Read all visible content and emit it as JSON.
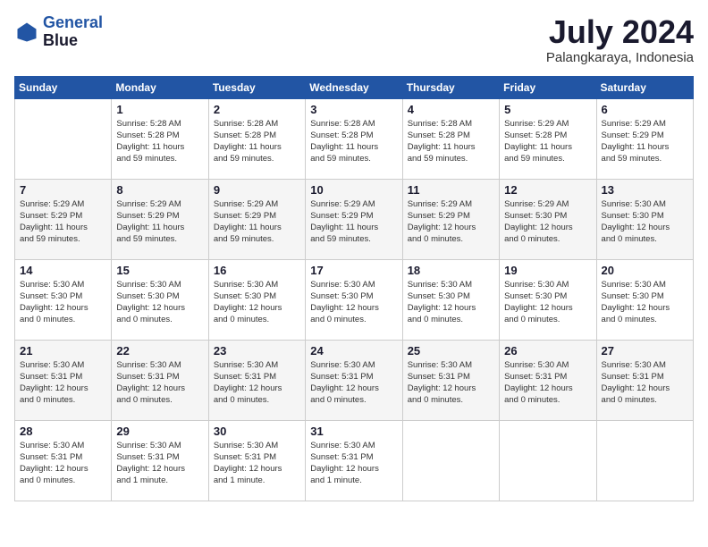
{
  "header": {
    "logo_line1": "General",
    "logo_line2": "Blue",
    "month_year": "July 2024",
    "location": "Palangkaraya, Indonesia"
  },
  "days_of_week": [
    "Sunday",
    "Monday",
    "Tuesday",
    "Wednesday",
    "Thursday",
    "Friday",
    "Saturday"
  ],
  "weeks": [
    [
      {
        "day": "",
        "info": ""
      },
      {
        "day": "1",
        "info": "Sunrise: 5:28 AM\nSunset: 5:28 PM\nDaylight: 11 hours\nand 59 minutes."
      },
      {
        "day": "2",
        "info": "Sunrise: 5:28 AM\nSunset: 5:28 PM\nDaylight: 11 hours\nand 59 minutes."
      },
      {
        "day": "3",
        "info": "Sunrise: 5:28 AM\nSunset: 5:28 PM\nDaylight: 11 hours\nand 59 minutes."
      },
      {
        "day": "4",
        "info": "Sunrise: 5:28 AM\nSunset: 5:28 PM\nDaylight: 11 hours\nand 59 minutes."
      },
      {
        "day": "5",
        "info": "Sunrise: 5:29 AM\nSunset: 5:28 PM\nDaylight: 11 hours\nand 59 minutes."
      },
      {
        "day": "6",
        "info": "Sunrise: 5:29 AM\nSunset: 5:29 PM\nDaylight: 11 hours\nand 59 minutes."
      }
    ],
    [
      {
        "day": "7",
        "info": "Sunrise: 5:29 AM\nSunset: 5:29 PM\nDaylight: 11 hours\nand 59 minutes."
      },
      {
        "day": "8",
        "info": "Sunrise: 5:29 AM\nSunset: 5:29 PM\nDaylight: 11 hours\nand 59 minutes."
      },
      {
        "day": "9",
        "info": "Sunrise: 5:29 AM\nSunset: 5:29 PM\nDaylight: 11 hours\nand 59 minutes."
      },
      {
        "day": "10",
        "info": "Sunrise: 5:29 AM\nSunset: 5:29 PM\nDaylight: 11 hours\nand 59 minutes."
      },
      {
        "day": "11",
        "info": "Sunrise: 5:29 AM\nSunset: 5:29 PM\nDaylight: 12 hours\nand 0 minutes."
      },
      {
        "day": "12",
        "info": "Sunrise: 5:29 AM\nSunset: 5:30 PM\nDaylight: 12 hours\nand 0 minutes."
      },
      {
        "day": "13",
        "info": "Sunrise: 5:30 AM\nSunset: 5:30 PM\nDaylight: 12 hours\nand 0 minutes."
      }
    ],
    [
      {
        "day": "14",
        "info": "Sunrise: 5:30 AM\nSunset: 5:30 PM\nDaylight: 12 hours\nand 0 minutes."
      },
      {
        "day": "15",
        "info": "Sunrise: 5:30 AM\nSunset: 5:30 PM\nDaylight: 12 hours\nand 0 minutes."
      },
      {
        "day": "16",
        "info": "Sunrise: 5:30 AM\nSunset: 5:30 PM\nDaylight: 12 hours\nand 0 minutes."
      },
      {
        "day": "17",
        "info": "Sunrise: 5:30 AM\nSunset: 5:30 PM\nDaylight: 12 hours\nand 0 minutes."
      },
      {
        "day": "18",
        "info": "Sunrise: 5:30 AM\nSunset: 5:30 PM\nDaylight: 12 hours\nand 0 minutes."
      },
      {
        "day": "19",
        "info": "Sunrise: 5:30 AM\nSunset: 5:30 PM\nDaylight: 12 hours\nand 0 minutes."
      },
      {
        "day": "20",
        "info": "Sunrise: 5:30 AM\nSunset: 5:30 PM\nDaylight: 12 hours\nand 0 minutes."
      }
    ],
    [
      {
        "day": "21",
        "info": "Sunrise: 5:30 AM\nSunset: 5:31 PM\nDaylight: 12 hours\nand 0 minutes."
      },
      {
        "day": "22",
        "info": "Sunrise: 5:30 AM\nSunset: 5:31 PM\nDaylight: 12 hours\nand 0 minutes."
      },
      {
        "day": "23",
        "info": "Sunrise: 5:30 AM\nSunset: 5:31 PM\nDaylight: 12 hours\nand 0 minutes."
      },
      {
        "day": "24",
        "info": "Sunrise: 5:30 AM\nSunset: 5:31 PM\nDaylight: 12 hours\nand 0 minutes."
      },
      {
        "day": "25",
        "info": "Sunrise: 5:30 AM\nSunset: 5:31 PM\nDaylight: 12 hours\nand 0 minutes."
      },
      {
        "day": "26",
        "info": "Sunrise: 5:30 AM\nSunset: 5:31 PM\nDaylight: 12 hours\nand 0 minutes."
      },
      {
        "day": "27",
        "info": "Sunrise: 5:30 AM\nSunset: 5:31 PM\nDaylight: 12 hours\nand 0 minutes."
      }
    ],
    [
      {
        "day": "28",
        "info": "Sunrise: 5:30 AM\nSunset: 5:31 PM\nDaylight: 12 hours\nand 0 minutes."
      },
      {
        "day": "29",
        "info": "Sunrise: 5:30 AM\nSunset: 5:31 PM\nDaylight: 12 hours\nand 1 minute."
      },
      {
        "day": "30",
        "info": "Sunrise: 5:30 AM\nSunset: 5:31 PM\nDaylight: 12 hours\nand 1 minute."
      },
      {
        "day": "31",
        "info": "Sunrise: 5:30 AM\nSunset: 5:31 PM\nDaylight: 12 hours\nand 1 minute."
      },
      {
        "day": "",
        "info": ""
      },
      {
        "day": "",
        "info": ""
      },
      {
        "day": "",
        "info": ""
      }
    ]
  ]
}
